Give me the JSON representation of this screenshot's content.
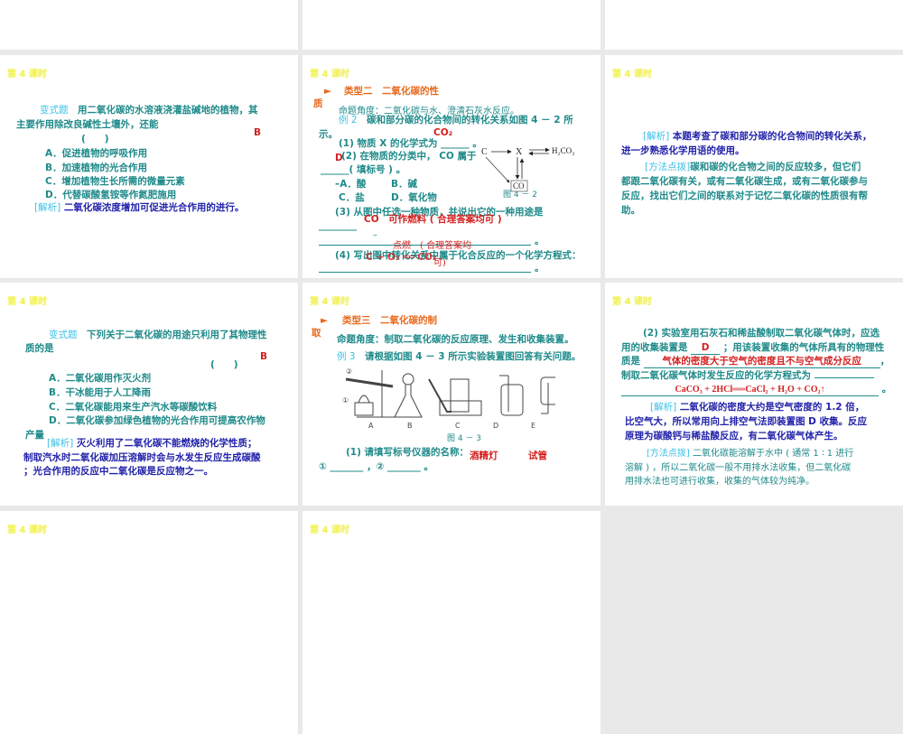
{
  "header": "第 4 课时",
  "slide_q1": {
    "label": "变式题",
    "stem1": "用二氧化碳的水溶液浇灌盐碱地的植物，其",
    "stem2": "主要作用除改良碱性土壤外，还能",
    "paren": "(　　)",
    "answer": "B",
    "options": [
      "A．促进植物的呼吸作用",
      "B．加速植物的光合作用",
      "C．增加植物生长所需的微量元素",
      "D．代替碳酸氢铵等作氮肥施用"
    ],
    "analysis_label": "[解析]",
    "analysis": "二氧化碳浓度增加可促进光合作用的进行。"
  },
  "slide_ex2": {
    "arrow": "►",
    "type_title": "类型二　二氧化碳的性",
    "type_title2": "质",
    "angle": "命题角度：二氧化碳与水、澄清石灰水反应。",
    "ex_label": "例 2",
    "ex_text": "碳和部分碳的化合物间的转化关系如图 4 － 2 所",
    "ex_text2": "示。",
    "ans1": "CO₂",
    "q1": "(1) 物质 X 的化学式为 ______ 。",
    "ans2": "D",
    "q2": "(2) 在物质的分类中， CO 属于",
    "q2b": "______( 填标号 ) 。",
    "optA": "–A．酸",
    "optB": "B．碱",
    "optC": "C．盐",
    "optD": "D．氧化物",
    "q3": "(3) 从图中任选一种物质，并说出它的一种用途是",
    "ans3": "CO　可作燃料 ( 合理答案均可 )",
    "q3b": "________",
    "dash": "–",
    "blank_end": "。",
    "q4": "(4) 写出图中转化关系中属于化合反应的一个化学方程式：",
    "ans4a": "点燃　( 合理答案均",
    "ans4b": "C + O₂ ══ CO₂",
    "ans4c": "可)",
    "diagram": {
      "c": "C",
      "x": "X",
      "h2co3": "H₂CO₃",
      "co": "CO",
      "caption": "图 4 － 2"
    }
  },
  "slide_ex2_analysis": {
    "analysis_label": "[解析]",
    "analysis1": "本题考查了碳和部分碳的化合物间的转化关系，",
    "analysis2": "进一步熟悉化学用语的使用。",
    "method_label": "[方法点拨]",
    "method1": "碳和碳的化合物之间的反应较多，但它们",
    "method2": "都跟二氧化碳有关，或有二氧化碳生成，或有二氧化碳参与",
    "method3": "反应，找出它们之间的联系对于记忆二氧化碳的性质很有帮",
    "method4": "助。"
  },
  "slide_q2": {
    "label": "变式题",
    "stem1": "下列关于二氧化碳的用途只利用了其物理性",
    "stem2": "质的是",
    "paren": "(　　)",
    "answer": "B",
    "options": [
      "A．二氧化碳用作灭火剂",
      "B．干冰能用于人工降雨",
      "C．二氧化碳能用来生产汽水等碳酸饮料",
      "D．二氧化碳参加绿色植物的光合作用可提高农作物"
    ],
    "option_d2": "产量",
    "analysis_label": "[解析]",
    "analysis1": "灭火利用了二氧化碳不能燃烧的化学性质；",
    "analysis2": "制取汽水时二氧化碳加压溶解时会与水发生反应生成碳酸",
    "analysis3": "；光合作用的反应中二氧化碳是反应物之一。"
  },
  "slide_ex3": {
    "arrow": "►",
    "type_title": "类型三　二氧化碳的制",
    "type_title2": "取",
    "angle": "命题角度：制取二氧化碳的反应原理、发生和收集装置。",
    "ex_label": "例 3",
    "ex_text": "请根据如图 4 － 3 所示实验装置图回答有关问题。",
    "apparatus_labels": [
      "A",
      "B",
      "C",
      "D",
      "E"
    ],
    "marks": [
      "①",
      "②"
    ],
    "caption": "图 4 － 3",
    "q1": "(1) 请填写标号仪器的名称：",
    "ans1": "酒精灯",
    "ans2": "试管",
    "blanks": "① _______ ，② _______ 。"
  },
  "slide_ex3b": {
    "q2a": "(2) 实验室用石灰石和稀盐酸制取二氧化碳气体时，应选",
    "q2b_pre": "用的收集装置是",
    "ans_d": "D",
    "q2b_post": "；用该装置收集的气体所具有的物理性",
    "q2c_pre": "质是",
    "ans_prop": "气体的密度大于空气的密度且不与空气成分反应",
    "comma": "，",
    "q2d": "制取二氧化碳气体时发生反应的化学方程式为",
    "ans_eq": "CaCO₃ + 2HCl══CaCl₂ + H₂O + CO₂↑",
    "period": "。",
    "analysis_label": "[解析]",
    "analysis1": "二氧化碳的密度大约是空气密度的 1.2 倍，",
    "analysis2": "比空气大，所以常用向上排空气法即装置图 D 收集。反应",
    "analysis3": "原理为碳酸钙与稀盐酸反应，有二氧化碳气体产生。",
    "method_label": "[方法点拨]",
    "method1": "二氧化碳能溶解于水中 ( 通常 1 ∶ 1 进行",
    "method2": "溶解 ) ，所以二氧化碳一般不用排水法收集，但二氧化碳",
    "method3": "用排水法也可进行收集，收集的气体较为纯净。"
  }
}
